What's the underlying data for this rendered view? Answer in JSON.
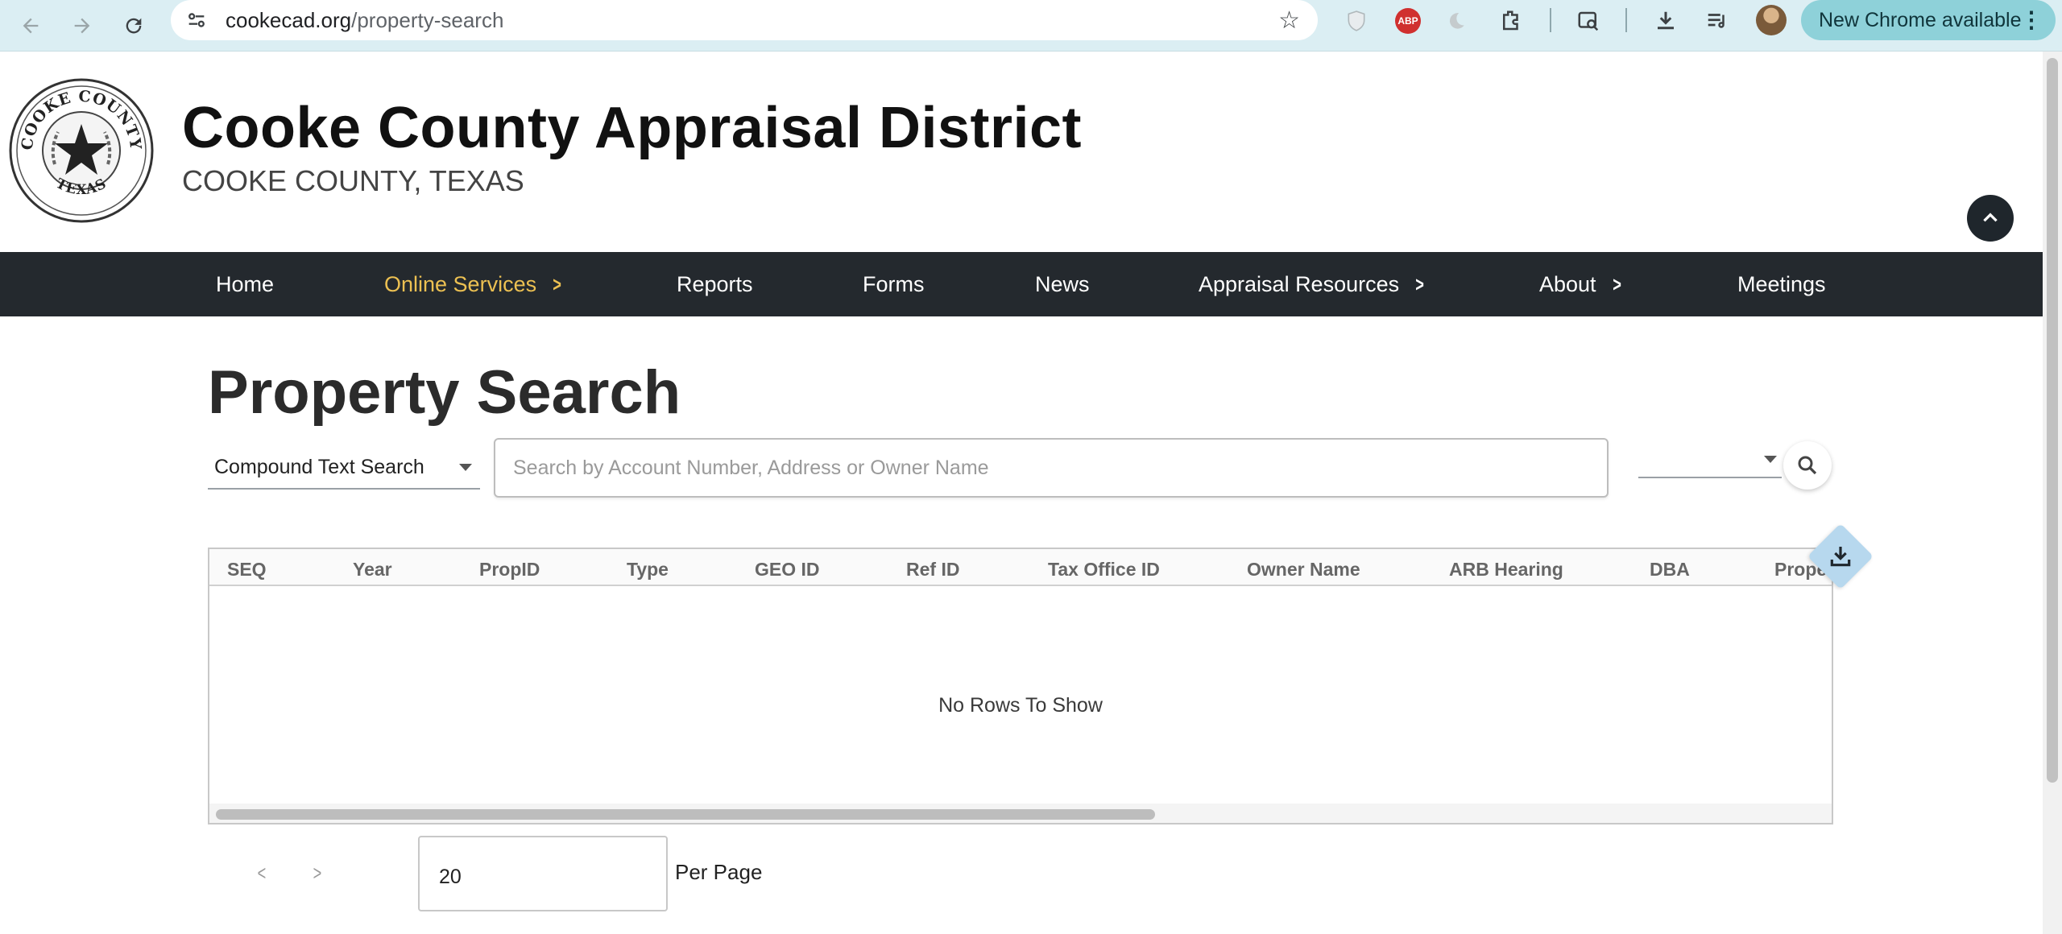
{
  "browser": {
    "url_host": "cookecad.org",
    "url_path": "/property-search",
    "update_label": "New Chrome available",
    "menu_glyph": "⋮",
    "icons": [
      "back-icon",
      "forward-icon",
      "reload-icon",
      "site-info-icon",
      "bookmark-star-icon",
      "privacy-shield-icon",
      "adblock-icon",
      "moon-icon",
      "extensions-icon",
      "search-tab-icon",
      "download-icon",
      "reading-list-icon",
      "profile-avatar"
    ],
    "adblock_text": "ABP"
  },
  "header": {
    "title": "Cooke County Appraisal District",
    "subtitle": "COOKE COUNTY, TEXAS",
    "seal_top_text": "COOKE COUNTY",
    "seal_bottom_text": "TEXAS"
  },
  "nav": {
    "items": [
      {
        "label": "Home"
      },
      {
        "label": "Online Services"
      },
      {
        "label": "Reports"
      },
      {
        "label": "Forms"
      },
      {
        "label": "News"
      },
      {
        "label": "Appraisal Resources"
      },
      {
        "label": "About"
      },
      {
        "label": "Meetings"
      }
    ],
    "active": "Online Services",
    "active_color": "#ecc052",
    "bar_color": "#24292e"
  },
  "main": {
    "title": "Property Search",
    "search_type": "Compound Text Search",
    "search_placeholder": "Search by Account Number, Address or Owner Name",
    "search_value": "",
    "year_value": ""
  },
  "grid": {
    "columns": [
      "SEQ",
      "Year",
      "PropID",
      "Type",
      "GEO ID",
      "Ref ID",
      "Tax Office ID",
      "Owner Name",
      "ARB Hearing",
      "DBA",
      "Proper"
    ],
    "rows": [],
    "empty_message": "No Rows To Show"
  },
  "pagination": {
    "per_page_value": "20",
    "per_page_label": "Per Page",
    "prev_glyph": "<",
    "next_glyph": ">"
  }
}
